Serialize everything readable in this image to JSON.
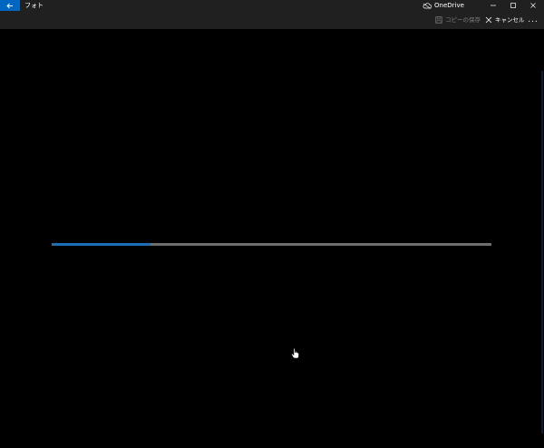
{
  "window": {
    "app_title": "フォト",
    "onedrive_label": "OneDrive"
  },
  "commandbar": {
    "save_copy_label": "コピーの保存",
    "cancel_label": "キャンセル",
    "more_label": "..."
  },
  "progress": {
    "fraction": 0.225
  },
  "colors": {
    "accent": "#0067c0",
    "progress_fill": "#1c6fb6",
    "progress_track": "#6e6e6e",
    "chrome": "#202020",
    "background": "#000000"
  }
}
